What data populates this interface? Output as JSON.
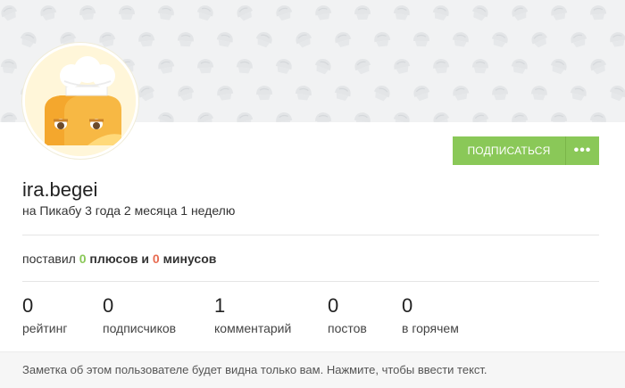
{
  "profile": {
    "username": "ira.begei",
    "since": "на Пикабу 3 года 2 месяца 1 неделю"
  },
  "actions": {
    "subscribe_label": "ПОДПИСАТЬСЯ",
    "more_label": "•••"
  },
  "votes": {
    "prefix": "поставил",
    "plus_count": "0",
    "plus_word": "плюсов",
    "conj": "и",
    "minus_count": "0",
    "minus_word": "минусов"
  },
  "stats": [
    {
      "value": "0",
      "label": "рейтинг"
    },
    {
      "value": "0",
      "label": "подписчиков"
    },
    {
      "value": "1",
      "label": "комментарий"
    },
    {
      "value": "0",
      "label": "постов"
    },
    {
      "value": "0",
      "label": "в горячем"
    }
  ],
  "note": {
    "text": "Заметка об этом пользователе будет видна только вам. Нажмите, чтобы ввести текст."
  },
  "colors": {
    "accent": "#8ac858",
    "minus": "#e86b51",
    "cover_bg": "#f1f2f3"
  },
  "icons": {
    "avatar": "chef-cupcake-avatar",
    "cover_pattern": "cupcake-pattern-icon",
    "more": "ellipsis-icon"
  }
}
